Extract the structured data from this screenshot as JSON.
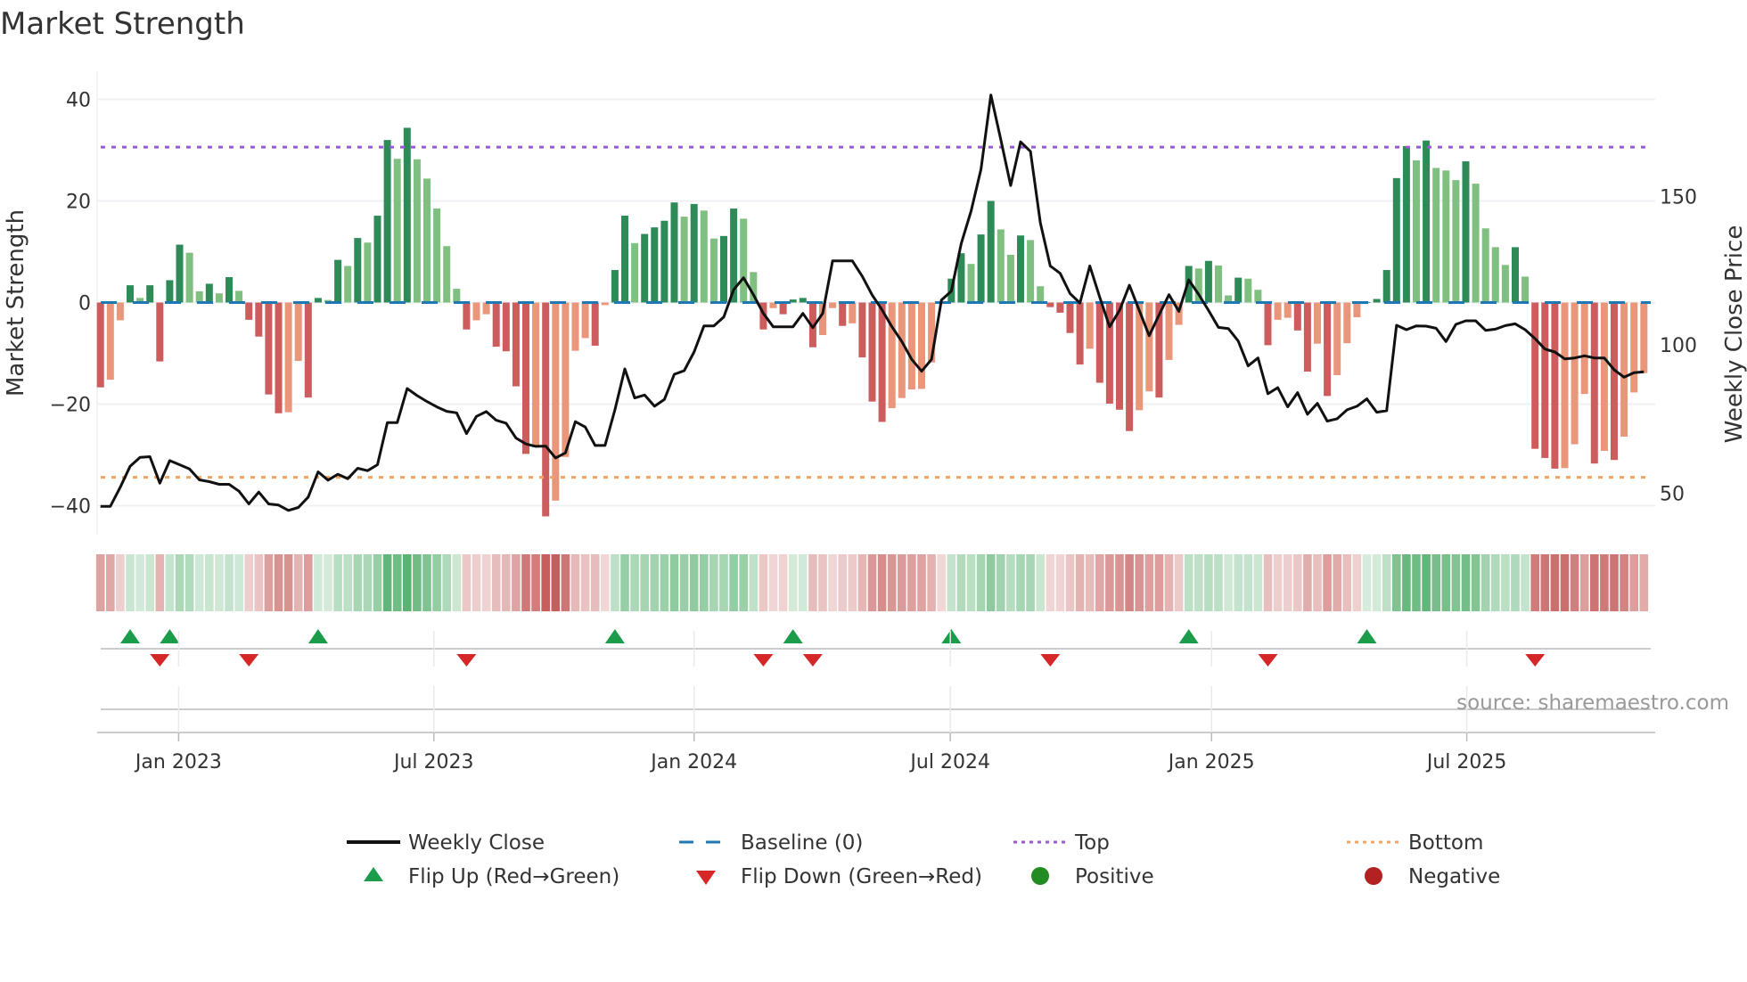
{
  "chart_data": {
    "type": "bar",
    "title": "Market Strength",
    "ylabel": "Market Strength",
    "y2label": "Weekly Close Price",
    "ylim": [
      -45,
      45
    ],
    "y2lim": [
      44,
      190
    ],
    "yticks": [
      -40,
      -20,
      0,
      20,
      40
    ],
    "y2ticks": [
      50,
      100,
      150
    ],
    "xticks": [
      {
        "label": "Jan 2023",
        "at_week": 7.9
      },
      {
        "label": "Jul 2023",
        "at_week": 33.7
      },
      {
        "label": "Jan 2024",
        "at_week": 60.0
      },
      {
        "label": "Jul 2024",
        "at_week": 85.9
      },
      {
        "label": "Jan 2025",
        "at_week": 112.3
      },
      {
        "label": "Jul 2025",
        "at_week": 138.1
      }
    ],
    "top_threshold": 30.6,
    "bottom_threshold": -34.4,
    "baseline": 0,
    "grid": true,
    "legend_position": "bottom",
    "strength": [
      -16.7,
      -15.2,
      -3.5,
      3.4,
      0.9,
      3.4,
      -11.6,
      4.4,
      11.4,
      9.8,
      2.2,
      3.7,
      1.8,
      5.0,
      2.3,
      -3.4,
      -6.7,
      -18.1,
      -21.8,
      -21.6,
      -11.5,
      -18.7,
      0.9,
      0.5,
      8.4,
      7.2,
      12.7,
      11.8,
      17.1,
      32.0,
      28.3,
      34.4,
      28.2,
      24.4,
      18.5,
      11.1,
      2.7,
      -5.3,
      -3.5,
      -2.3,
      -8.7,
      -9.6,
      -16.5,
      -29.8,
      -28.5,
      -42.1,
      -39.0,
      -30.4,
      -9.5,
      -7.0,
      -8.5,
      -0.5,
      6.4,
      17.1,
      11.7,
      13.5,
      14.8,
      16.1,
      19.7,
      16.9,
      19.4,
      18.1,
      12.6,
      13.1,
      18.5,
      16.5,
      6.0,
      -5.3,
      -1.1,
      -2.3,
      0.6,
      0.9,
      -8.8,
      -6.4,
      -1.1,
      -4.6,
      -4.1,
      -10.8,
      -19.5,
      -23.5,
      -20.8,
      -18.8,
      -17.1,
      -17.0,
      -11.8,
      -0.3,
      4.7,
      9.7,
      7.6,
      13.4,
      20.0,
      14.4,
      9.4,
      13.2,
      12.3,
      3.2,
      -0.9,
      -2.0,
      -6.0,
      -12.2,
      -9.1,
      -15.8,
      -19.9,
      -21.1,
      -25.3,
      -21.2,
      -17.5,
      -18.7,
      -11.3,
      -4.4,
      7.2,
      6.7,
      8.2,
      7.3,
      1.4,
      4.9,
      4.7,
      2.5,
      -8.4,
      -3.4,
      -3.0,
      -5.5,
      -13.6,
      -8.1,
      -18.4,
      -14.3,
      -8.0,
      -2.9,
      0.1,
      0.7,
      6.4,
      24.5,
      30.8,
      28.0,
      31.9,
      26.5,
      26.0,
      24.1,
      27.8,
      23.4,
      14.6,
      10.9,
      7.4,
      10.9,
      5.1,
      -28.8,
      -30.6,
      -32.7,
      -32.6,
      -27.9,
      -18.0,
      -31.7,
      -29.2,
      -31.0,
      -26.4,
      -17.7,
      -13.9
    ],
    "weekly_close": [
      45.6,
      45.6,
      52.0,
      59.1,
      62.1,
      62.3,
      53.4,
      61.0,
      59.6,
      58.2,
      54.5,
      53.9,
      53.0,
      53.0,
      50.7,
      46.4,
      50.4,
      46.4,
      46.0,
      44.2,
      45.2,
      48.7,
      57.2,
      54.4,
      56.4,
      54.9,
      58.4,
      57.6,
      59.6,
      73.8,
      73.8,
      85.3,
      82.9,
      80.9,
      79.1,
      77.6,
      77.1,
      70.1,
      75.9,
      77.5,
      74.6,
      73.6,
      68.6,
      66.6,
      65.8,
      65.9,
      61.9,
      63.6,
      74.1,
      72.3,
      66.1,
      66.1,
      78.1,
      91.9,
      82.1,
      83.1,
      79.3,
      81.6,
      90.1,
      91.3,
      97.6,
      106.4,
      106.4,
      109.4,
      118.6,
      122.6,
      116.9,
      110.6,
      106.1,
      106.1,
      106.1,
      110.6,
      105.8,
      110.6,
      128.3,
      128.3,
      128.3,
      123.1,
      116.8,
      111.8,
      106.1,
      101.1,
      95.1,
      91.1,
      95.1,
      115.1,
      118.1,
      134.1,
      145.1,
      159.2,
      184.2,
      169.2,
      153.7,
      168.4,
      165.2,
      141.1,
      126.6,
      124.1,
      117.3,
      114.1,
      126.6,
      116.1,
      106.1,
      111.6,
      120.1,
      111.6,
      103.1,
      110.1,
      116.9,
      111.3,
      121.9,
      117.0,
      111.6,
      105.9,
      105.5,
      101.3,
      92.9,
      95.6,
      83.5,
      85.6,
      79.1,
      83.9,
      76.6,
      80.3,
      74.3,
      75.1,
      78.1,
      79.3,
      81.8,
      77.3,
      77.8,
      106.6,
      105.1,
      106.4,
      106.3,
      105.6,
      101.1,
      106.9,
      108.1,
      108.1,
      104.9,
      105.3,
      106.5,
      107.1,
      105.1,
      102.1,
      98.6,
      97.6,
      95.3,
      95.6,
      96.3,
      95.6,
      95.6,
      91.6,
      89.1,
      90.6,
      90.9
    ],
    "legend": [
      {
        "label": "Weekly Close",
        "kind": "line"
      },
      {
        "label": "Baseline (0)",
        "kind": "dashed"
      },
      {
        "label": "Top",
        "kind": "dotted-top"
      },
      {
        "label": "Bottom",
        "kind": "dotted-bottom"
      },
      {
        "label": "Flip Up (Red→Green)",
        "kind": "tri-up"
      },
      {
        "label": "Flip Down (Green→Red)",
        "kind": "tri-down"
      },
      {
        "label": "Positive",
        "kind": "dot-pos"
      },
      {
        "label": "Negative",
        "kind": "dot-neg"
      }
    ],
    "source": "source: sharemaestro.com"
  },
  "colors": {
    "pos_strong": "#2e8b57",
    "pos_weak": "#7fbf7f",
    "neg_strong": "#cd5c5c",
    "neg_weak": "#e9967a",
    "baseline": "#1f77b4",
    "top": "#9b59d6",
    "bottom": "#f4a460",
    "flip_up": "#1a9c4a",
    "flip_down": "#d62728",
    "positive": "#228b22",
    "negative": "#b22222",
    "close": "#111111"
  }
}
